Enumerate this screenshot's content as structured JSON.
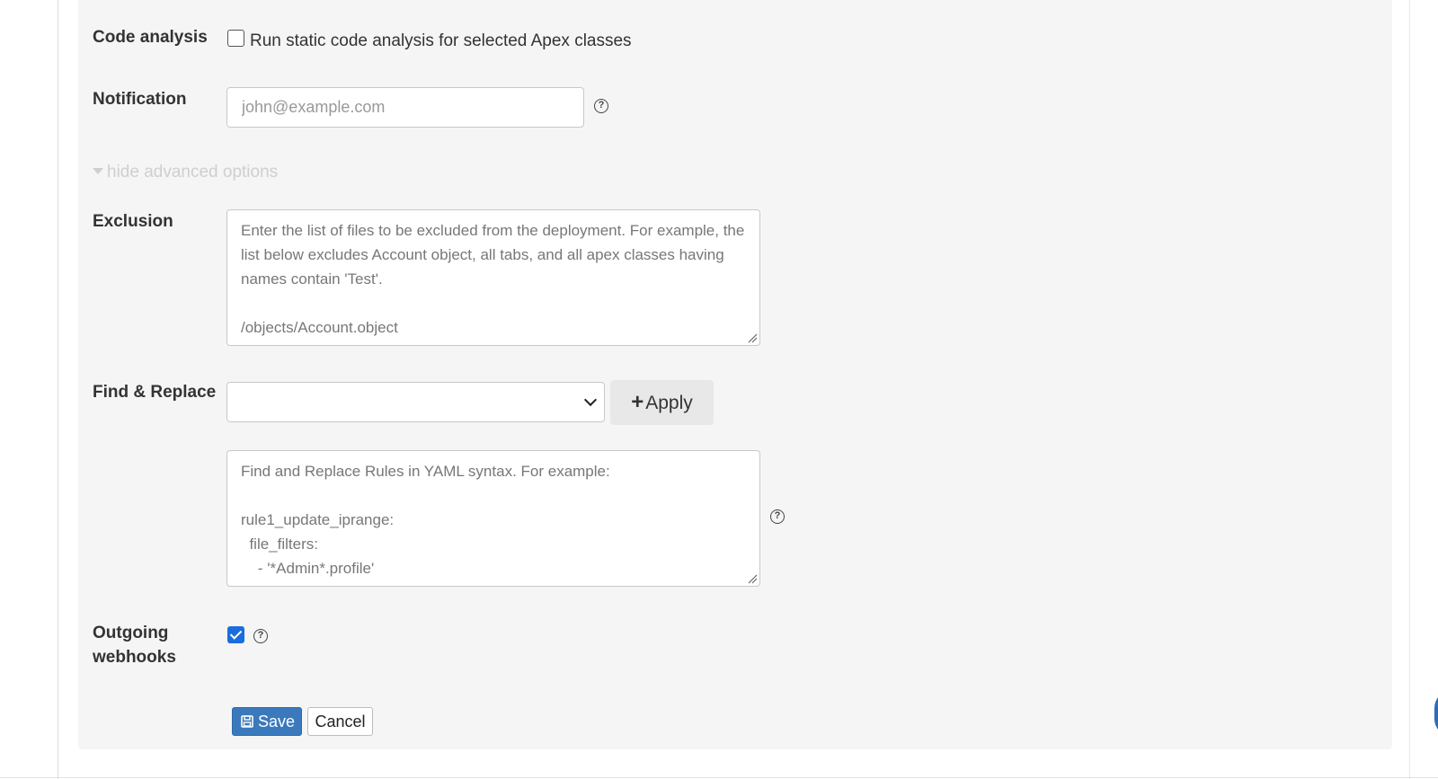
{
  "code_analysis": {
    "label": "Code analysis",
    "checkbox_label": "Run static code analysis for selected Apex classes",
    "checked": false
  },
  "notification": {
    "label": "Notification",
    "placeholder": "john@example.com",
    "help": "?"
  },
  "advanced_toggle": "hide advanced options",
  "exclusion": {
    "label": "Exclusion",
    "placeholder": "Enter the list of files to be excluded from the deployment. For example, the list below excludes Account object, all tabs, and all apex classes having names contain 'Test'.\n\n/objects/Account.object\n/tabs"
  },
  "find_replace": {
    "label": "Find & Replace",
    "select_value": "",
    "apply_label": "Apply",
    "rules_placeholder": "Find and Replace Rules in YAML syntax. For example:\n\nrule1_update_iprange:\n  file_filters:\n    - '*Admin*.profile'\n    - '*Guest*.profile'",
    "help": "?"
  },
  "outgoing_webhooks": {
    "label": "Outgoing webhooks",
    "checked": true,
    "help": "?"
  },
  "actions": {
    "save_label": "Save",
    "cancel_label": "Cancel"
  },
  "colors": {
    "primary": "#3b79bd",
    "panel": "#f5f5f5",
    "checkbox_checked": "#1a6ddc",
    "muted_toggle": "#cfcfcf"
  }
}
